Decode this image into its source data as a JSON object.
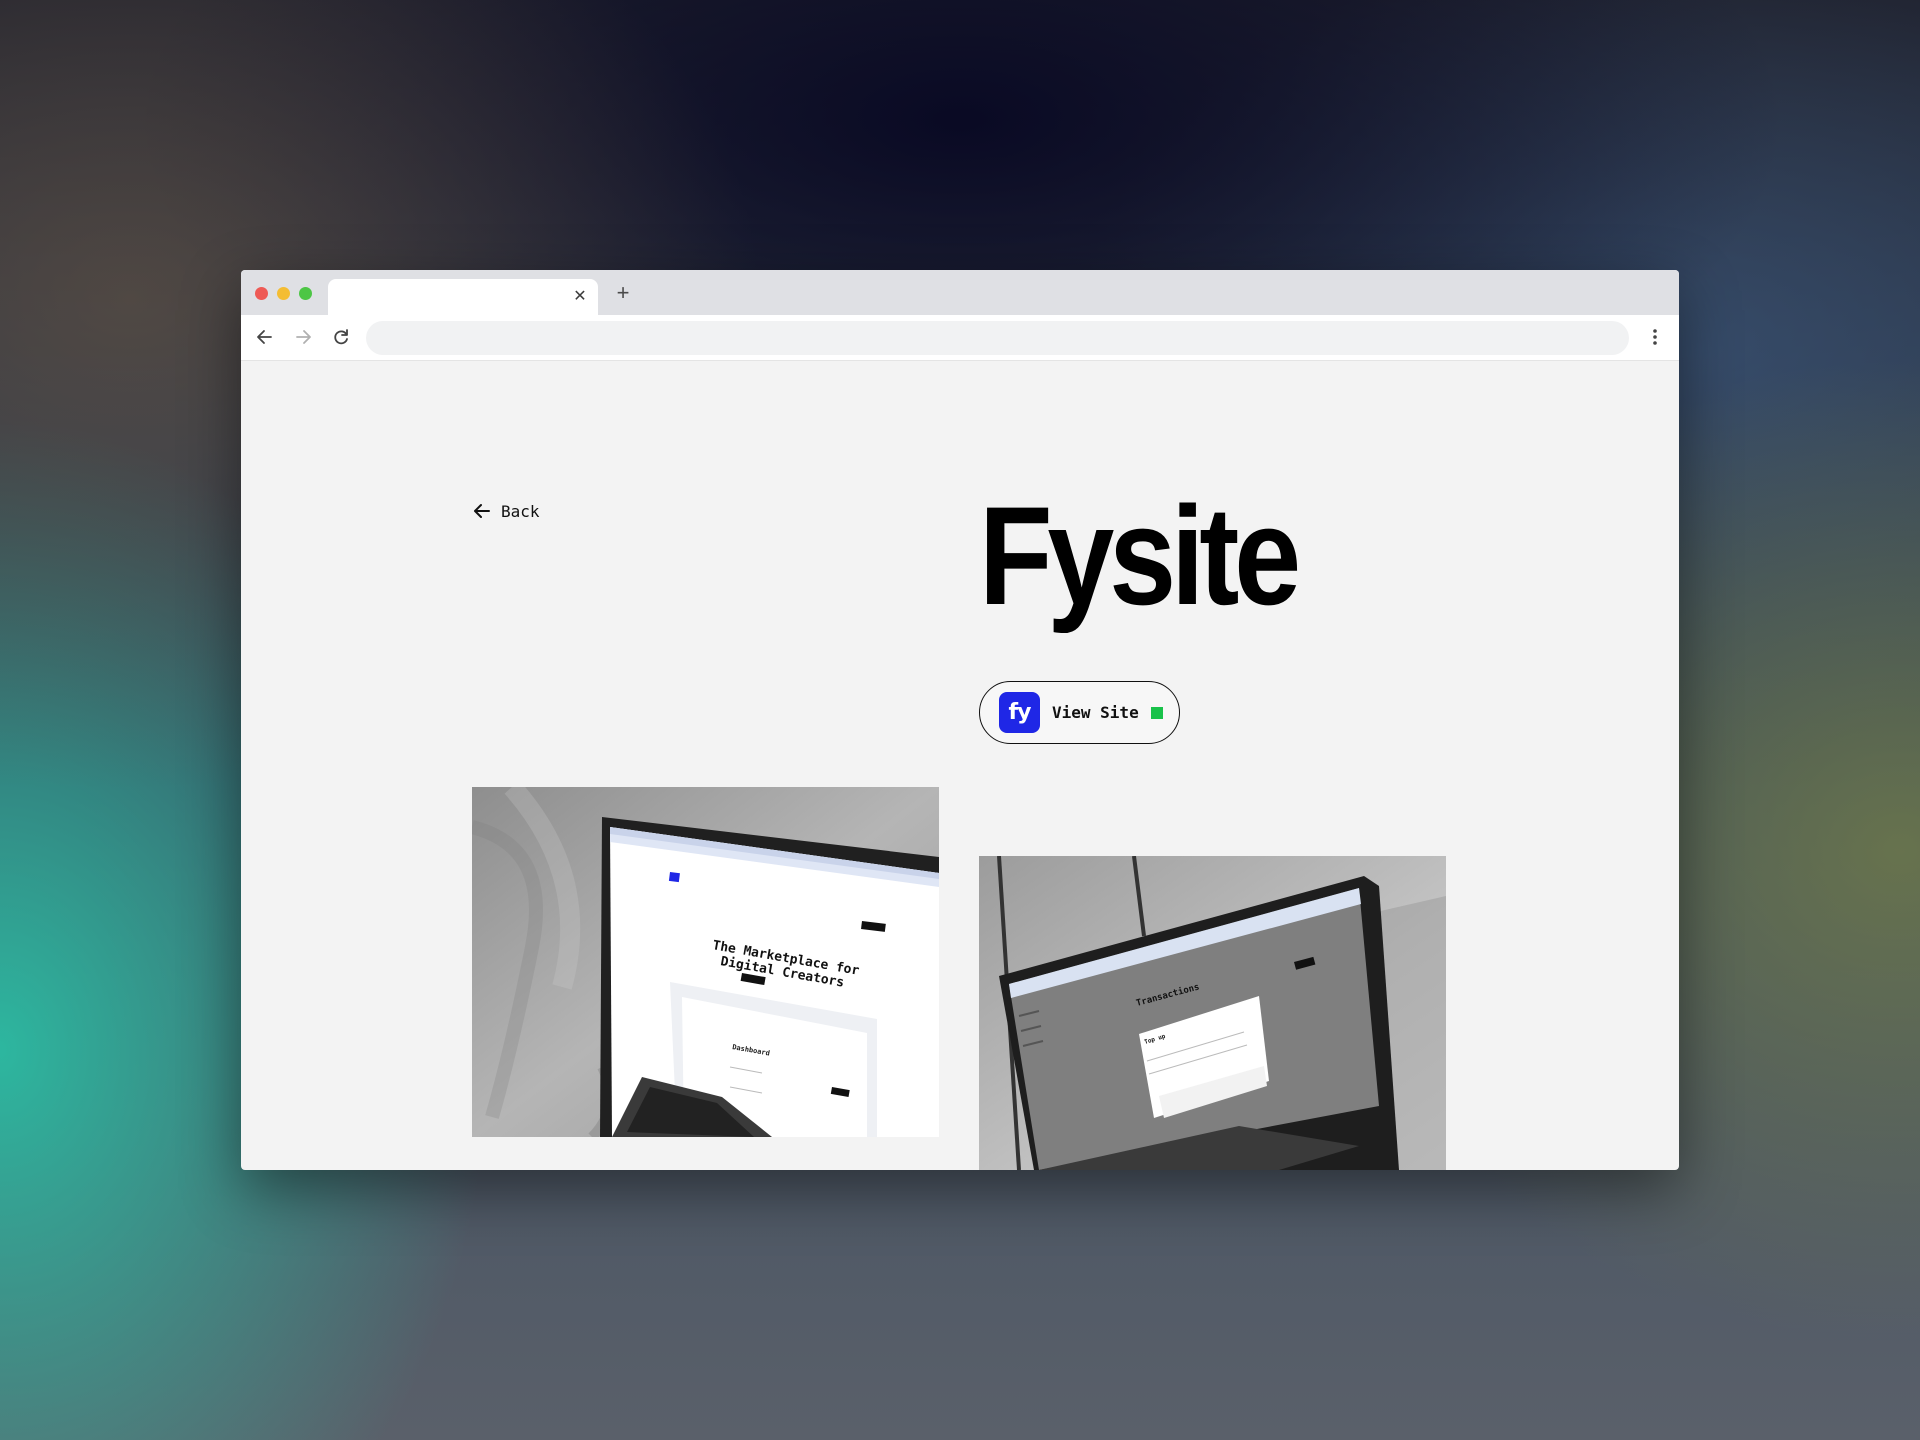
{
  "browser": {
    "tab_title": "",
    "tab_close_icon": "close-icon",
    "new_tab_icon": "plus-icon",
    "address": "",
    "nav_icons": [
      "arrow-left-icon",
      "arrow-right-icon",
      "reload-icon",
      "kebab-menu-icon"
    ]
  },
  "page": {
    "back_label": "Back",
    "title": "Fysite",
    "view_site": {
      "logo_text": "fy",
      "label": "View Site",
      "logo_color": "#1f27e6",
      "status_color": "#19c24a"
    }
  },
  "photo1": {
    "heading_line1": "The Marketplace for",
    "heading_line2": "Digital Creators",
    "panel_title": "Dashboard"
  },
  "photo2": {
    "heading": "Transactions",
    "modal_title": "Top up"
  }
}
